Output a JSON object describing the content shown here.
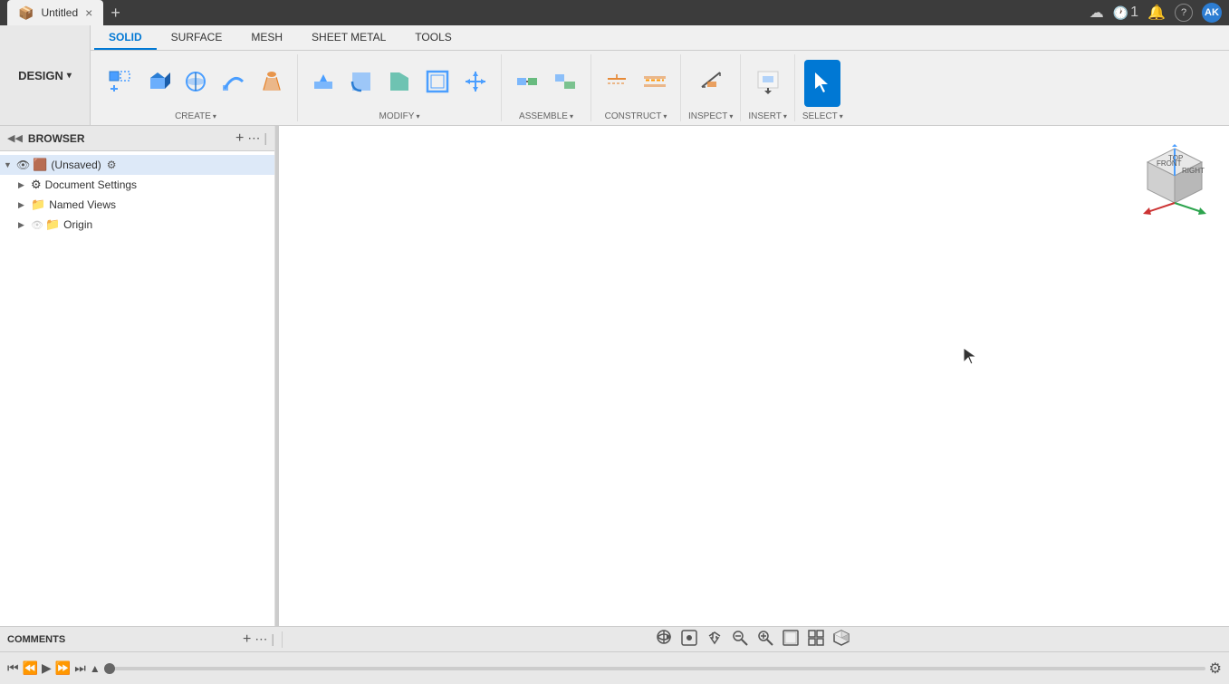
{
  "titleBar": {
    "tab": {
      "icon": "📦",
      "title": "Untitled",
      "closeLabel": "×"
    },
    "addTabIcon": "+",
    "cloudIcon": "☁",
    "timerLabel": "1",
    "bellIcon": "🔔",
    "helpIcon": "?",
    "avatar": "AK"
  },
  "toolbar": {
    "designButton": "DESIGN",
    "designChevron": "▾",
    "tabs": [
      {
        "id": "solid",
        "label": "SOLID",
        "active": true
      },
      {
        "id": "surface",
        "label": "SURFACE",
        "active": false
      },
      {
        "id": "mesh",
        "label": "MESH",
        "active": false
      },
      {
        "id": "sheetmetal",
        "label": "SHEET METAL",
        "active": false
      },
      {
        "id": "tools",
        "label": "TOOLS",
        "active": false
      }
    ],
    "groups": [
      {
        "id": "create",
        "label": "CREATE",
        "items": [
          {
            "id": "new-component",
            "icon": "⊞",
            "label": ""
          },
          {
            "id": "extrude",
            "icon": "📦",
            "label": ""
          },
          {
            "id": "revolve",
            "icon": "🔵",
            "label": ""
          },
          {
            "id": "sweep",
            "icon": "➰",
            "label": ""
          },
          {
            "id": "loft",
            "icon": "🔺",
            "label": ""
          }
        ]
      },
      {
        "id": "modify",
        "label": "MODIFY",
        "items": [
          {
            "id": "press-pull",
            "icon": "⬆",
            "label": ""
          },
          {
            "id": "fillet",
            "icon": "🔲",
            "label": ""
          },
          {
            "id": "chamfer",
            "icon": "🔷",
            "label": ""
          },
          {
            "id": "shell",
            "icon": "◻",
            "label": ""
          },
          {
            "id": "move",
            "icon": "✛",
            "label": ""
          }
        ]
      },
      {
        "id": "assemble",
        "label": "ASSEMBLE",
        "items": [
          {
            "id": "joint",
            "icon": "🔗",
            "label": ""
          },
          {
            "id": "as-built-joint",
            "icon": "📐",
            "label": ""
          }
        ]
      },
      {
        "id": "construct",
        "label": "CONSTRUCT",
        "items": [
          {
            "id": "offset-plane",
            "icon": "📏",
            "label": ""
          },
          {
            "id": "midplane",
            "icon": "🔶",
            "label": ""
          }
        ]
      },
      {
        "id": "inspect",
        "label": "INSPECT",
        "items": [
          {
            "id": "measure",
            "icon": "📐",
            "label": ""
          }
        ]
      },
      {
        "id": "insert",
        "label": "INSERT",
        "items": [
          {
            "id": "insert-derive",
            "icon": "🖼",
            "label": ""
          }
        ]
      },
      {
        "id": "select",
        "label": "SELECT",
        "items": [
          {
            "id": "select-tool",
            "icon": "↖",
            "label": ""
          }
        ],
        "active": true
      }
    ]
  },
  "browser": {
    "title": "BROWSER",
    "collapseIcon": "◀◀",
    "addIcon": "+",
    "optionsIcon": "⋯",
    "dividerIcon": "|",
    "tree": [
      {
        "id": "root",
        "label": "(Unsaved)",
        "icon": "🟫",
        "expanded": true,
        "depth": 0,
        "hasEye": true,
        "hasSettings": true
      },
      {
        "id": "doc-settings",
        "label": "Document Settings",
        "icon": "⚙",
        "expanded": false,
        "depth": 1
      },
      {
        "id": "named-views",
        "label": "Named Views",
        "icon": "📁",
        "expanded": false,
        "depth": 1
      },
      {
        "id": "origin",
        "label": "Origin",
        "icon": "📁",
        "expanded": false,
        "depth": 1,
        "hasEye": true
      }
    ]
  },
  "viewport": {
    "background": "#ffffff"
  },
  "axisCube": {
    "front": "FRONT",
    "right": "RIGHT",
    "top": "TOP"
  },
  "comments": {
    "label": "COMMENTS",
    "addIcon": "+",
    "optionsIcon": "⋯",
    "dividerIcon": "|"
  },
  "viewportControls": [
    {
      "id": "orbit",
      "icon": "⊕"
    },
    {
      "id": "look-at",
      "icon": "⊡"
    },
    {
      "id": "pan",
      "icon": "✋"
    },
    {
      "id": "zoom-fit",
      "icon": "🔍-"
    },
    {
      "id": "zoom",
      "icon": "🔍"
    },
    {
      "id": "display-mode",
      "icon": "⬜"
    },
    {
      "id": "grid",
      "icon": "⊞"
    },
    {
      "id": "view-cube",
      "icon": "⬛"
    }
  ],
  "timeline": {
    "rewindLabel": "⏮",
    "stepBackLabel": "⏪",
    "playLabel": "▶",
    "stepForwardLabel": "⏩",
    "fastForwardLabel": "⏭",
    "markerIcon": "▲",
    "settingsIcon": "⚙"
  }
}
